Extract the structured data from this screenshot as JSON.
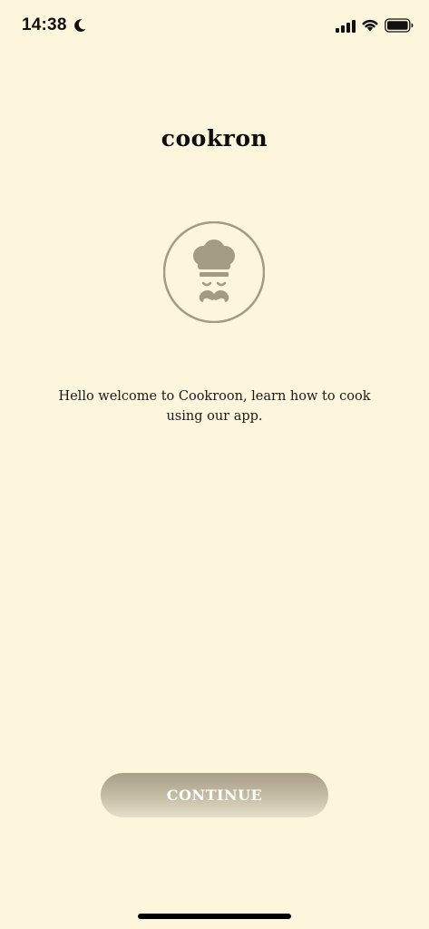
{
  "status_bar": {
    "time": "14:38",
    "icons": [
      "moon-icon",
      "cellular-signal-icon",
      "wifi-icon",
      "battery-icon"
    ]
  },
  "header": {
    "title": "cookron"
  },
  "logo": {
    "icon": "chef-hat-mustache-icon",
    "color": "#a49b84"
  },
  "main": {
    "welcome_text": "Hello welcome to Cookroon, learn how to cook using our app."
  },
  "actions": {
    "continue_label": "CONTINUE"
  },
  "colors": {
    "background": "#fdf6dc",
    "accent": "#a49b84"
  }
}
